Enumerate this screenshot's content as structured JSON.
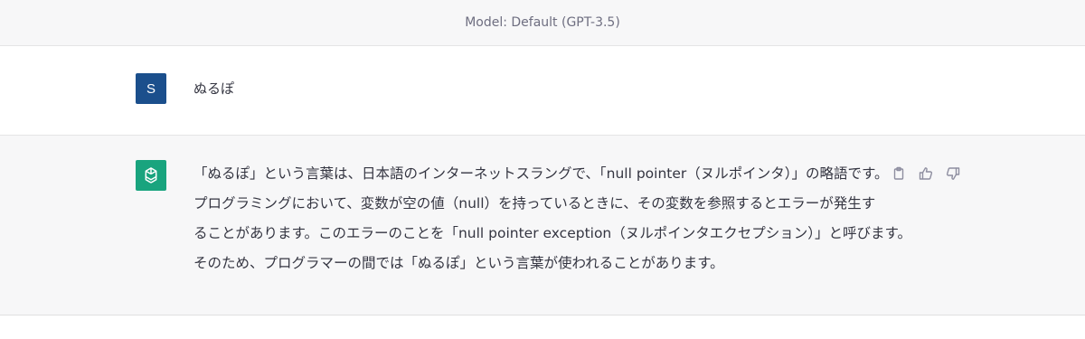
{
  "header": {
    "model_label": "Model: Default (GPT-3.5)"
  },
  "user_message": {
    "avatar_letter": "S",
    "text": "ぬるぽ"
  },
  "assistant_message": {
    "lines": [
      "「ぬるぽ」という言葉は、日本語のインターネットスラングで、「null pointer（ヌルポインタ）」の略語です。",
      "プログラミングにおいて、変数が空の値（null）を持っているときに、その変数を参照するとエラーが発生す",
      "ることがあります。このエラーのことを「null pointer exception（ヌルポインタエクセプション）」と呼びます。",
      "そのため、プログラマーの間では「ぬるぽ」という言葉が使われることがあります。"
    ],
    "actions": [
      "copy-icon",
      "thumbs-up-icon",
      "thumbs-down-icon"
    ]
  },
  "colors": {
    "user_avatar": "#1b4f8c",
    "assistant_avatar": "#19a47e",
    "assistant_bg": "#f7f7f8"
  }
}
